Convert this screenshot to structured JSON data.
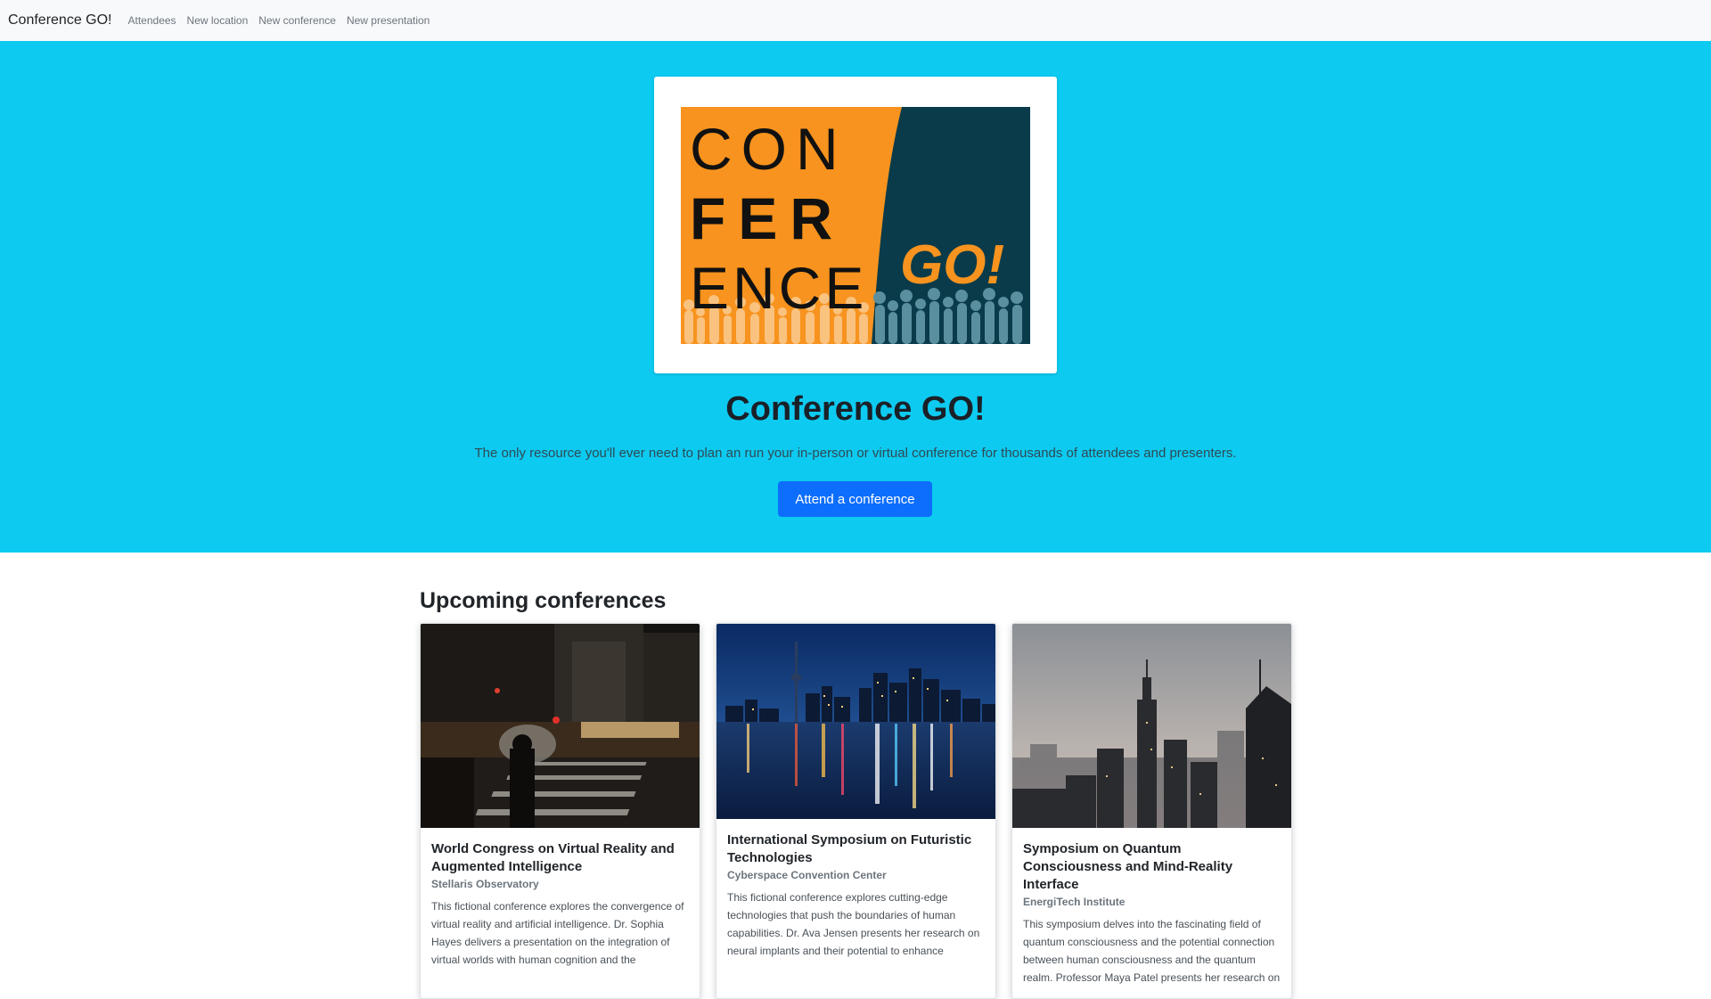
{
  "nav": {
    "brand": "Conference GO!",
    "links": [
      "Attendees",
      "New location",
      "New conference",
      "New presentation"
    ]
  },
  "hero": {
    "logo": {
      "lines": [
        "CON",
        "FER",
        "ENCE"
      ],
      "tag": "GO!",
      "colors": {
        "orange": "#f7931e",
        "teal": "#0a3b4a",
        "silhouette": "#5a8fa0"
      }
    },
    "title": "Conference GO!",
    "lead": "The only resource you'll ever need to plan an run your in-person or virtual conference for thousands of attendees and presenters.",
    "button_label": "Attend a conference",
    "colors": {
      "background": "#0dcaf0",
      "button": "#0d6efd"
    }
  },
  "section": {
    "title": "Upcoming conferences"
  },
  "conferences": [
    {
      "title": "World Congress on Virtual Reality and Augmented Intelligence",
      "location": "Stellaris Observatory",
      "description": "This fictional conference explores the convergence of virtual reality and artificial intelligence. Dr. Sophia Hayes delivers a presentation on the integration of virtual worlds with human cognition and the",
      "image": "night-crosswalk-photo"
    },
    {
      "title": "International Symposium on Futuristic Technologies",
      "location": "Cyberspace Convention Center",
      "description": "This fictional conference explores cutting-edge technologies that push the boundaries of human capabilities. Dr. Ava Jensen presents her research on neural implants and their potential to enhance",
      "image": "city-skyline-reflection-photo"
    },
    {
      "title": "Symposium on Quantum Consciousness and Mind-Reality Interface",
      "location": "EnergiTech Institute",
      "description": "This symposium delves into the fascinating field of quantum consciousness and the potential connection between human consciousness and the quantum realm. Professor Maya Patel presents her research on",
      "image": "foggy-skyscrapers-photo"
    }
  ]
}
